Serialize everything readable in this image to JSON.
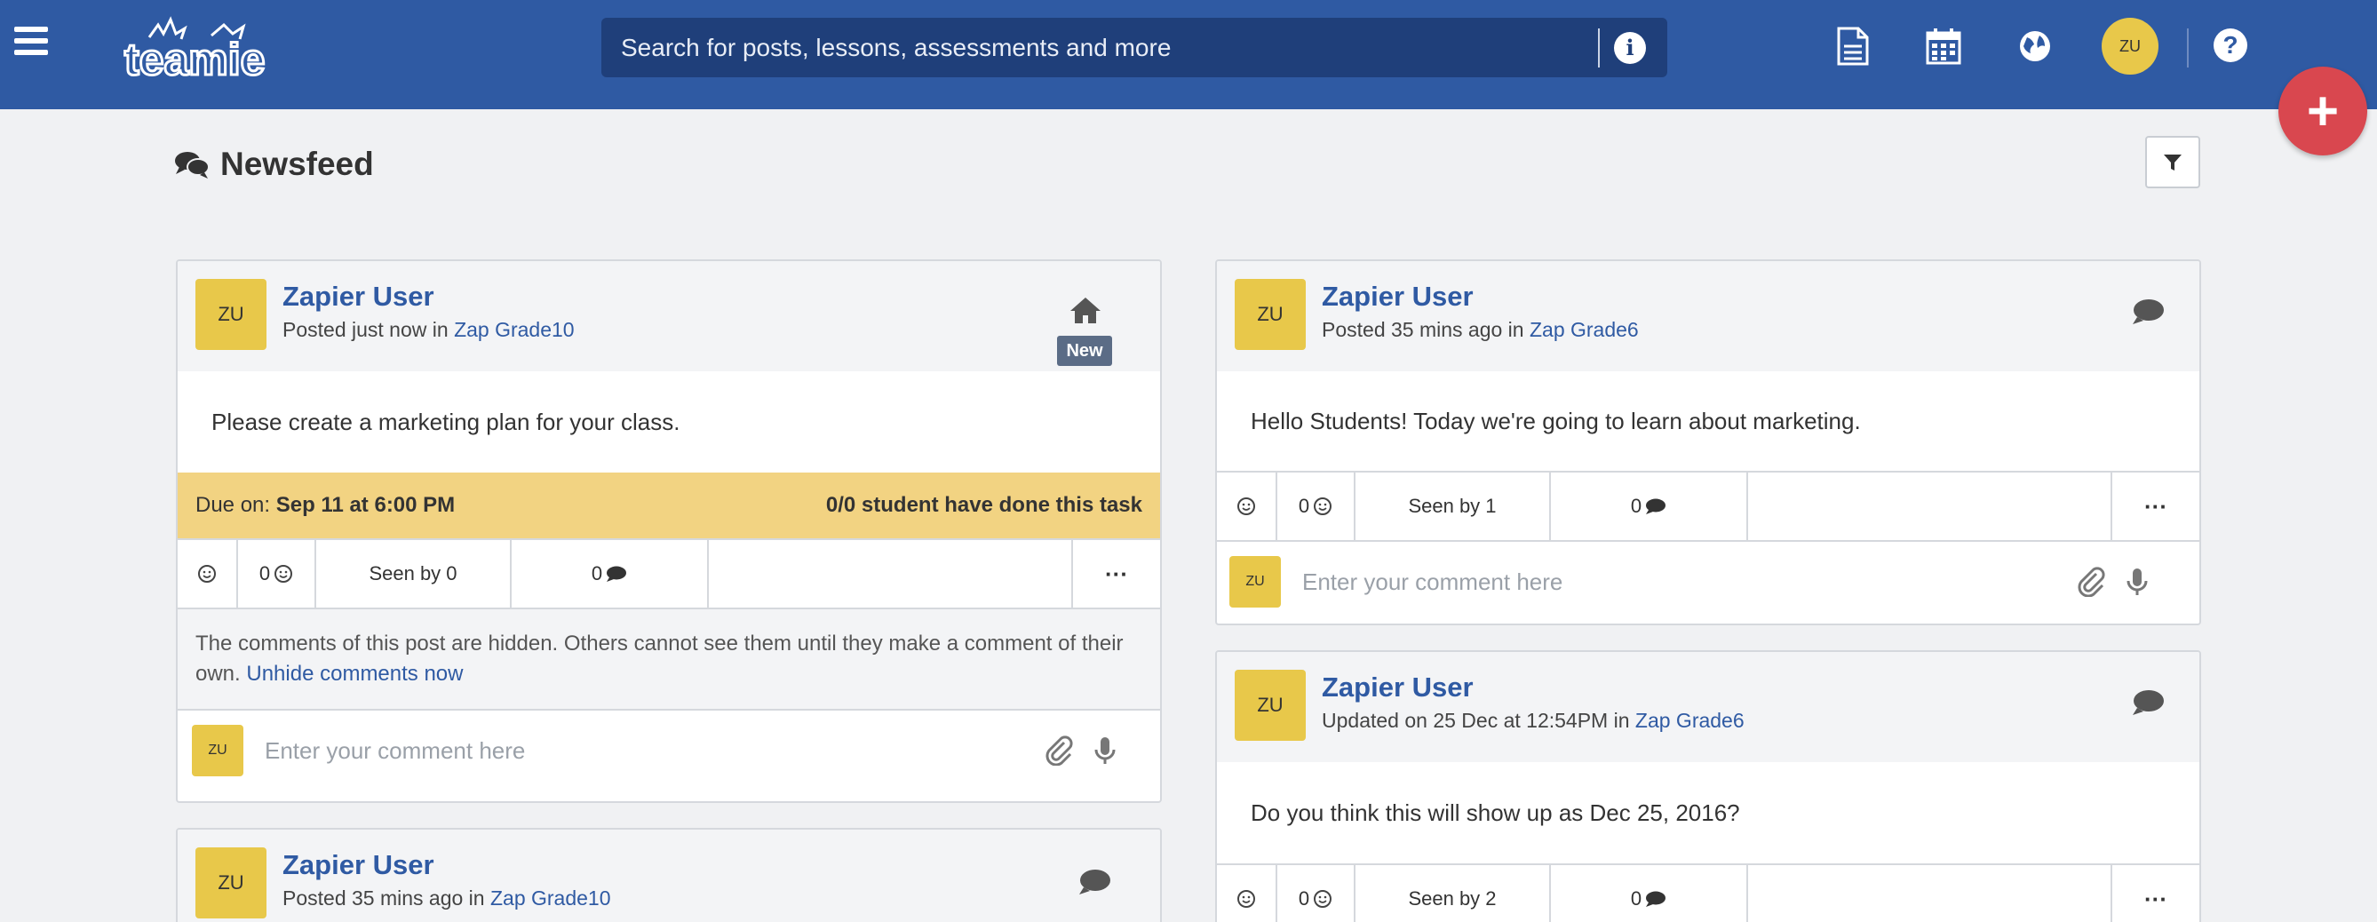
{
  "header": {
    "search_placeholder": "Search for posts, lessons, assessments and more",
    "avatar_initials": "ZU",
    "help_label": "?",
    "fab_label": "+",
    "info_label": "i"
  },
  "page": {
    "title": "Newsfeed"
  },
  "posts": [
    {
      "author": "Zapier User",
      "avatar": "ZU",
      "time_prefix": "Posted just now in",
      "class": "Zap Grade10",
      "badge": "New",
      "body": "Please create a marketing plan for your class.",
      "due_label": "Due on:",
      "due_date": "Sep 11 at 6:00 PM",
      "done_status": "0/0 student have done this task",
      "reaction_count": "0",
      "seen": "Seen by 0",
      "comment_count": "0",
      "more": "···",
      "hidden_note": "The comments of this post are hidden. Others cannot see them until they make a comment of their own.",
      "unhide_link": "Unhide comments now",
      "comment_avatar": "ZU",
      "comment_placeholder": "Enter your comment here"
    },
    {
      "author": "Zapier User",
      "avatar": "ZU",
      "time_prefix": "Posted 35 mins ago in",
      "class": "Zap Grade6",
      "body": "Hello Students! Today we're going to learn about marketing.",
      "reaction_count": "0",
      "seen": "Seen by 1",
      "comment_count": "0",
      "more": "···",
      "comment_avatar": "ZU",
      "comment_placeholder": "Enter your comment here"
    },
    {
      "author": "Zapier User",
      "avatar": "ZU",
      "time_prefix": "Updated on 25 Dec at 12:54PM in",
      "class": "Zap Grade6",
      "body": "Do you think this will show up as Dec 25, 2016?",
      "reaction_count": "0",
      "seen": "Seen by 2",
      "comment_count": "0",
      "more": "···"
    },
    {
      "author": "Zapier User",
      "avatar": "ZU",
      "time_prefix": "Posted 35 mins ago in",
      "class": "Zap Grade10"
    }
  ]
}
